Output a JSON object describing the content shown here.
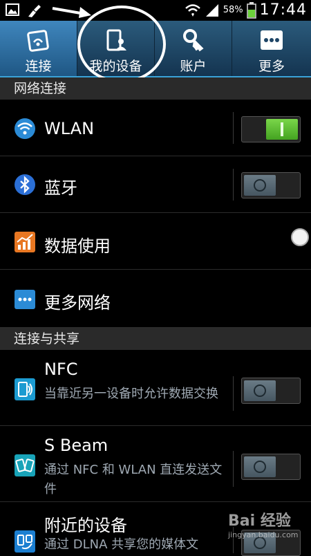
{
  "status_bar": {
    "battery": "58%",
    "time": "17:44"
  },
  "tabs": [
    {
      "label": "连接",
      "icon": "connections-icon"
    },
    {
      "label": "我的设备",
      "icon": "my-device-icon"
    },
    {
      "label": "账户",
      "icon": "accounts-key-icon"
    },
    {
      "label": "更多",
      "icon": "more-dots-icon"
    }
  ],
  "sections": {
    "network": "网络连接",
    "connect_share": "连接与共享"
  },
  "rows": {
    "wlan": {
      "title": "WLAN",
      "toggle": "on"
    },
    "bluetooth": {
      "title": "蓝牙",
      "toggle": "off"
    },
    "data_usage": {
      "title": "数据使用"
    },
    "more_networks": {
      "title": "更多网络"
    },
    "nfc": {
      "title": "NFC",
      "subtitle": "当靠近另一设备时允许数据交换",
      "toggle": "off"
    },
    "sbeam": {
      "title": "S Beam",
      "subtitle": "通过 NFC 和 WLAN 直连发送文件",
      "toggle": "off"
    },
    "nearby": {
      "title": "附近的设备",
      "subtitle": "通过 DLNA 共享您的媒体文",
      "toggle": "off"
    }
  },
  "watermark": {
    "main": "Bai 经验",
    "sub": "jingyan.baidu.com"
  },
  "colors": {
    "tab_bar": "#1e4566",
    "tab_active": "#3576a8",
    "toggle_on": "#5cc233",
    "section_bg": "#2a2a2a"
  }
}
